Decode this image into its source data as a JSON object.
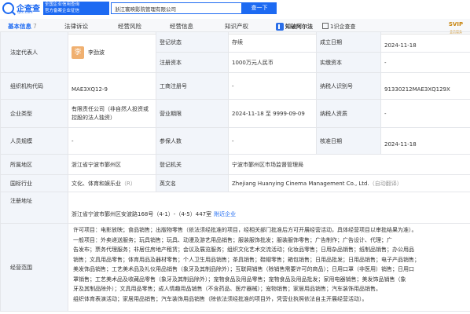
{
  "header": {
    "brand_name": "企查查",
    "brand_url": "Qcc.com",
    "slogan_line1": "全国企业信用查询",
    "slogan_line2": "官方备案企业征信",
    "search_value": "浙江寰映影院管理有限公司",
    "search_button": "查一下"
  },
  "tabs": {
    "items": [
      {
        "label": "基本信息",
        "count": "7"
      },
      {
        "label": "法律诉讼",
        "count": ""
      },
      {
        "label": "经营风险",
        "count": ""
      },
      {
        "label": "经营信息",
        "count": ""
      },
      {
        "label": "知识产权",
        "count": ""
      }
    ],
    "zhishi_label": "知破阿尔法",
    "gerenzhang_label": "1识企查查",
    "svip_label": "SVIP",
    "svip_sub": "会员服务"
  },
  "info": {
    "legal_rep_label": "法定代表人",
    "legal_rep_avatar": "李",
    "legal_rep_name": "李劲波",
    "reg_status_label": "登记状态",
    "reg_status_value": "存续",
    "established_label": "成立日期",
    "established_value": "2024-11-18",
    "reg_capital_label": "注册资本",
    "reg_capital_value": "1000万元人民币",
    "paid_capital_label": "实缴资本",
    "paid_capital_value": "-",
    "org_code_label": "组织机构代码",
    "org_code_value": "MAE3XQ12-9",
    "biz_reg_no_label": "工商注册号",
    "biz_reg_no_value": "-",
    "taxpayer_no_label": "纳税人识别号",
    "taxpayer_no_value": "91330212MAE3XQ129X",
    "company_type_label": "企业类型",
    "company_type_value": "有限责任公司（非自然人投资或控股的法人独资）",
    "biz_term_label": "营业期限",
    "biz_term_value": "2024-11-18 至 9999-09-09",
    "taxpayer_qual_label": "纳税人资质",
    "taxpayer_qual_value": "-",
    "staff_size_label": "人员规模",
    "staff_size_value": "-",
    "insured_label": "参保人数",
    "insured_value": "-",
    "approval_date_label": "核准日期",
    "approval_date_value": "2024-11-18",
    "region_label": "所属地区",
    "region_value": "浙江省宁波市鄞州区",
    "reg_authority_label": "登记机关",
    "reg_authority_value": "宁波市鄞州区市场监督管理局",
    "industry_label": "国标行业",
    "industry_value": "文化、体育和娱乐业",
    "industry_suffix": "（R）",
    "english_name_label": "英文名",
    "english_name_value": "Zhejiang Huanying Cinema Management Co., Ltd.",
    "english_name_note": "（自动翻译）",
    "address_label": "注册地址",
    "address_value": "浙江省宁波市鄞州区安波路168号（4-1）-（4-5）447室",
    "address_link": "附近企业",
    "scope_label": "经营范围",
    "scope_lines": [
      "许可项目：电影放映；食品销售；出版物零售（依法须经批准的项目，经相关部门批准后方可开展经营活动，具体经营项目以审批结果为准）。",
      "一般项目：外卖递送服务；玩具销售；玩具、动漫及游艺用品销售；服装服饰批发；服装服饰零售；广告制作；广告设计、代理；广",
      "告发布；票务代理服务；非居住房地产租赁；会议及展览服务；组织文化艺术交流活动；化妆品零售；日用杂品销售；纸制品销售；办公用品",
      "销售；文具用品零售；体育用品及器材零售；个人卫生用品销售；茶具销售；鞋帽零售；箱包销售；日用品批发；日用品销售；电子产品销售；",
      "美发饰品销售；工艺美术品及礼仪用品销售（象牙及其制品除外）；互联网销售（除销售需要许可的商品）；日用口罩（非医用）销售；日用口",
      "罩销售；工艺美术品及收藏品零售（象牙及其制品除外）；宠物食品及用品零售；宠物食品及用品批发；家用电器销售；美发饰品销售（象",
      "牙及其制品除外）；文具用品零售；成人情趣用品销售（不含药品、医疗器械）；宠物销售；家居用品销售；汽车装饰用品销售。",
      "组织体育表演活动；家居用品销售；汽车装饰用品销售（除依法须经批准的项目外，凭营业执照依法自主开展经营活动）。"
    ]
  }
}
